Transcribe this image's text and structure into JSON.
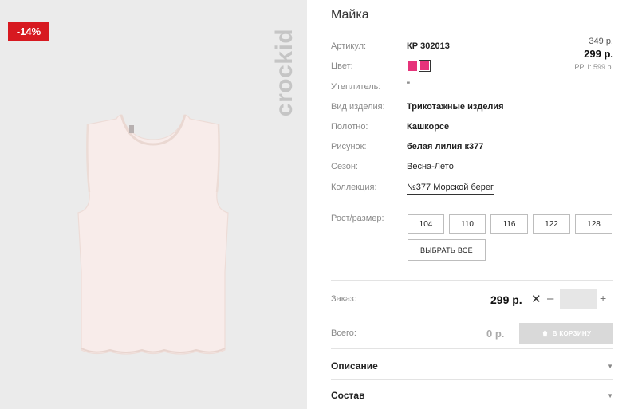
{
  "product": {
    "title": "Майка",
    "discount_badge": "-14%",
    "brand_logo": "crockid",
    "image_alt": "Майка"
  },
  "attributes": [
    {
      "label": "Артикул:",
      "value": "КР 302013"
    },
    {
      "label": "Цвет:",
      "value": ""
    },
    {
      "label": "Утеплитель:",
      "value": "\""
    },
    {
      "label": "Вид изделия:",
      "value": "Трикотажные изделия"
    },
    {
      "label": "Полотно:",
      "value": "Кашкорсе"
    },
    {
      "label": "Рисунок:",
      "value": "белая лилия к377"
    },
    {
      "label": "Сезон:",
      "value": "Весна-Лето"
    },
    {
      "label": "Коллекция:",
      "value": "№377 Морской берег"
    }
  ],
  "price": {
    "old": "349 р.",
    "current": "299 р.",
    "rrp": "РРЦ: 599 р."
  },
  "colors": {
    "swatches": [
      "#e6337a",
      "#e6337a"
    ],
    "accent_red": "#d71920"
  },
  "sizes": {
    "label": "Рост/размер:",
    "options": [
      "104",
      "110",
      "116",
      "122",
      "128"
    ],
    "select_all": "ВЫБРАТЬ ВСЕ"
  },
  "order": {
    "label": "Заказ:",
    "price": "299 р.",
    "times": "✕",
    "minus": "–",
    "plus": "+",
    "quantity": ""
  },
  "total": {
    "label": "Всего:",
    "value": "0 р.",
    "cart_button": "В КОРЗИНУ"
  },
  "accordion": [
    {
      "label": "Описание"
    },
    {
      "label": "Состав"
    }
  ]
}
